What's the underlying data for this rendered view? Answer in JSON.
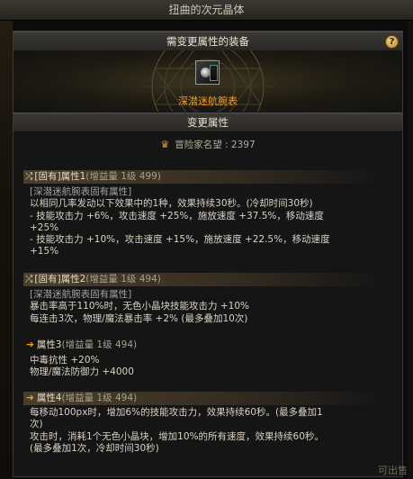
{
  "window": {
    "title": "扭曲的次元晶体"
  },
  "equip_section": {
    "header": "需变更属性的装备",
    "help_label": "?",
    "item_icon": "wristwatch-icon",
    "item_name": "深潜迷航腕表"
  },
  "change_section": {
    "header": "变更属性"
  },
  "reputation": {
    "label": "冒险家名望",
    "value": "2397",
    "icon": "reputation-emblem-icon"
  },
  "attributes": [
    {
      "tag": "[固有]属性1",
      "gain": "(增益量 1级 499)",
      "style": "selected",
      "lines": [
        {
          "text": "[深潜迷航腕表固有属性]",
          "muted": true
        },
        {
          "text": "以相同几率发动以下效果中的1种，效果持续30秒。(冷却时间30秒)"
        },
        {
          "text": "- 技能攻击力 +6%，攻击速度 +25%，施放速度 +37.5%，移动速度"
        },
        {
          "text": "+25%"
        },
        {
          "text": "- 技能攻击力 +10%，攻击速度 +15%，施放速度 +22.5%，移动速度"
        },
        {
          "text": "+15%"
        }
      ]
    },
    {
      "tag": "[固有]属性2",
      "gain": "(增益量 1级 494)",
      "style": "selected",
      "lines": [
        {
          "text": "[深潜迷航腕表固有属性]",
          "muted": true
        },
        {
          "text": "暴击率高于110%时，无色小晶块技能攻击力 +10%"
        },
        {
          "text": "每连击3次，物理/魔法暴击率 +2% (最多叠加10次)"
        }
      ]
    },
    {
      "tag": "属性3",
      "gain": "(增益量 1级 494)",
      "style": "plain",
      "lines": [
        {
          "text": "中毒抗性 +20%"
        },
        {
          "text": "物理/魔法防御力 +4000"
        }
      ]
    },
    {
      "tag": "属性4",
      "gain": "(增益量 1级 494)",
      "style": "selected",
      "lines": [
        {
          "text": "每移动100px时，增加6%的技能攻击力，效果持续60秒。(最多叠加1"
        },
        {
          "text": "次)"
        },
        {
          "text": "攻击时，消耗1个无色小晶块，增加10%的所有速度，效果持续60秒。"
        },
        {
          "text": "(最多叠加1次，冷却时间30秒)"
        }
      ]
    }
  ],
  "background_text": "可出售",
  "colors": {
    "accent_orange": "#f2a21e",
    "text_light": "#d7d2c4",
    "text_muted": "#a3a0a0",
    "panel_bg": "#151515"
  }
}
